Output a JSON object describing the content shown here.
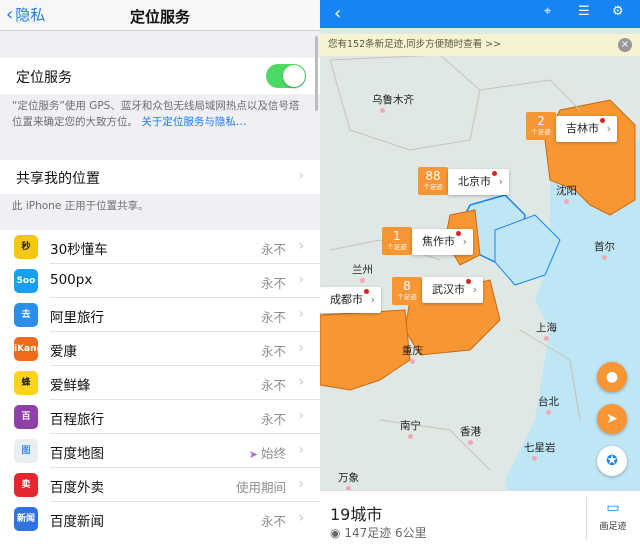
{
  "left": {
    "nav": {
      "back_label": "隐私",
      "title": "定位服务"
    },
    "location_services": {
      "label": "定位服务",
      "enabled": true
    },
    "footnote": {
      "text": "“定位服务”使用 GPS、蓝牙和众包无线局域网热点以及信号塔位置来确定您的大致方位。",
      "link": "关于定位服务与隐私…"
    },
    "share_location": {
      "label": "共享我的位置",
      "note": "此 iPhone 正用于位置共享。"
    },
    "apps": [
      {
        "name": "30秒懂车",
        "status": "永不",
        "icon_text": "秒",
        "icon_color": "#f5c518",
        "icon_fg": "#222222"
      },
      {
        "name": "500px",
        "status": "永不",
        "icon_text": "5oo",
        "icon_color": "#1a9ff0",
        "icon_fg": "#ffffff"
      },
      {
        "name": "阿里旅行",
        "status": "永不",
        "icon_text": "去",
        "icon_color": "#2b8ee8",
        "icon_fg": "#ffffff"
      },
      {
        "name": "爱康",
        "status": "永不",
        "icon_text": "iKang",
        "icon_color": "#f06a1d",
        "icon_fg": "#ffffff"
      },
      {
        "name": "爱鲜蜂",
        "status": "永不",
        "icon_text": "蜂",
        "icon_color": "#ffd21f",
        "icon_fg": "#222222"
      },
      {
        "name": "百程旅行",
        "status": "永不",
        "icon_text": "百",
        "icon_color": "#8e3fa8",
        "icon_fg": "#ffffff"
      },
      {
        "name": "百度地图",
        "status": "始终",
        "icon_text": "图",
        "icon_color": "#e9eef2",
        "icon_fg": "#3d8af7",
        "arrow": true
      },
      {
        "name": "百度外卖",
        "status": "使用期间",
        "icon_text": "卖",
        "icon_color": "#e4262f",
        "icon_fg": "#ffffff"
      },
      {
        "name": "百度新闻",
        "status": "永不",
        "icon_text": "新闻",
        "icon_color": "#2f72e0",
        "icon_fg": "#ffffff"
      }
    ]
  },
  "right": {
    "topbar": {
      "back_icon": "chevron-left-icon",
      "icons": [
        "location-pin-icon",
        "list-icon",
        "settings-icon"
      ]
    },
    "banner": {
      "text": "您有152条新足迹,同步方便随时查看 >>"
    },
    "places": [
      {
        "id": "wulumuqi",
        "name": "乌鲁木齐"
      },
      {
        "id": "lanzhou",
        "name": "兰州"
      },
      {
        "id": "shenyang",
        "name": "沈阳"
      },
      {
        "id": "shouer",
        "name": "首尔"
      },
      {
        "id": "shanghai",
        "name": "上海"
      },
      {
        "id": "taibei",
        "name": "台北"
      },
      {
        "id": "nanning",
        "name": "南宁"
      },
      {
        "id": "xianggang",
        "name": "香港"
      },
      {
        "id": "qixing",
        "name": "七星岩"
      },
      {
        "id": "wanxiang",
        "name": "万象"
      },
      {
        "id": "chongqing",
        "name": "重庆"
      }
    ],
    "clusters": [
      {
        "id": "jilin",
        "count": "2",
        "unit": "个足迹",
        "city": "吉林市"
      },
      {
        "id": "beijing",
        "count": "88",
        "unit": "个足迹",
        "city": "北京市"
      },
      {
        "id": "jiaozuo",
        "count": "1",
        "unit": "个足迹",
        "city": "焦作市"
      },
      {
        "id": "wuhan",
        "count": "8",
        "unit": "个足迹",
        "city": "武汉市"
      },
      {
        "id": "chengdu",
        "count": "",
        "unit": "",
        "city": "成都市"
      }
    ],
    "summary": {
      "cities": "19城市",
      "footprints": "147足迹",
      "distance": "6公里"
    },
    "draw_button": {
      "label": "画足迹"
    },
    "colors": {
      "accent": "#1784f5",
      "region": "#f79633",
      "water": "#bfe6f5"
    }
  }
}
